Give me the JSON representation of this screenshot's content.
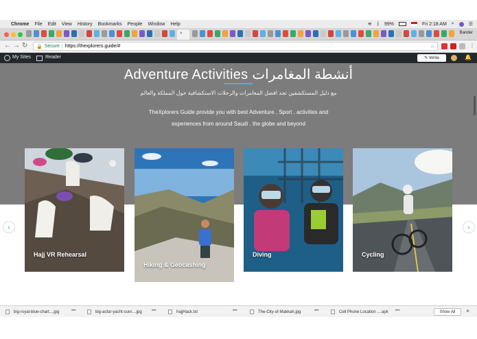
{
  "menubar": {
    "app": "Chrome",
    "items": [
      "File",
      "Edit",
      "View",
      "History",
      "Bookmarks",
      "People",
      "Window",
      "Help"
    ],
    "battery": "99%",
    "clock": "Fri 2:18 AM"
  },
  "browser": {
    "active_tab_label": "×",
    "profile": "Bander",
    "url_secure": "Secure",
    "url_sep": "|",
    "url": "https://thexplorers.guide/#"
  },
  "wp_admin": {
    "my_sites": "My Sites",
    "reader": "Reader",
    "write": "Write"
  },
  "hero": {
    "title": "Adventure Activities أنشطة المغامرات",
    "subtitle_ar": "مع دليل المستكشفين تجد افضل المغامرات والرحلات الاستكشافية حول المملكة والعالم",
    "description": "TheXplorers Guide provide you with best Adventure , Sport , activities and experiences from around Saudi , the globe and beyond"
  },
  "cards": [
    {
      "label": "Hajj VR Rehearsal"
    },
    {
      "label": "Hiking & Geocashing"
    },
    {
      "label": "Diving"
    },
    {
      "label": "Cycling"
    }
  ],
  "downloads": {
    "items": [
      "big-royal-blue-chart....jpg",
      "big-asfar-yacht-sunr....jpg",
      "hajjHack.txt",
      "The-City-of-Makkah.jpg",
      "Cell Phone Location ....apk"
    ],
    "more": "•••",
    "show_all": "Show All",
    "close": "✕"
  },
  "colors": {
    "hero_bg": "#7c7c7c",
    "wp_bar": "#23282d",
    "accent_underline": "#5aa8d8"
  }
}
